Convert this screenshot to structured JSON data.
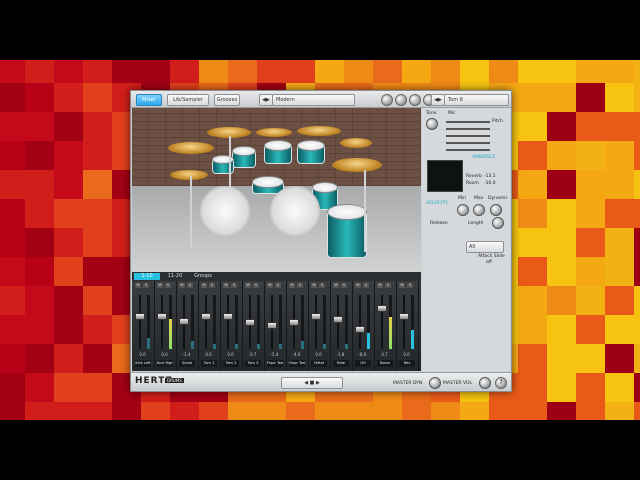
{
  "toolbar": {
    "mixer_label": "Mixer",
    "library_label": "Lib/Sampler",
    "grooves_label": "Grooves",
    "kit_name": "Modern",
    "preset_name": "Tom 8"
  },
  "stage_tabs": [
    "1-10",
    "11-20",
    "Groups"
  ],
  "side_panel": {
    "tone_label": "Tone",
    "mic_label": "Mic",
    "pitch_label": "Pitch",
    "ambience_label": "AMBIENCE",
    "velocity_label": "VELOCITY",
    "reverb_label": "Reverb",
    "reverb_value": "-13.5",
    "room_label": "Room",
    "room_value": "-16.0",
    "min_label": "Min",
    "max_label": "Max",
    "dynamic_label": "Dynamic",
    "release_label": "Release",
    "length_label": "Length",
    "dropdown_value": "All",
    "attack_label": "Attack Slide",
    "off_label": "off"
  },
  "mixer": {
    "channels": [
      {
        "name": "Kick Left",
        "value": "0.0",
        "level": 0.2
      },
      {
        "name": "Kick Right",
        "value": "0.0",
        "level": 0.55
      },
      {
        "name": "Snare",
        "value": "-3.4",
        "level": 0.15
      },
      {
        "name": "Tom 1",
        "value": "0.0",
        "level": 0.1
      },
      {
        "name": "Tom 2",
        "value": "0.0",
        "level": 0.1
      },
      {
        "name": "Tom 3",
        "value": "-3.7",
        "level": 0.1
      },
      {
        "name": "Floor Tom 1",
        "value": "-5.4",
        "level": 0.1
      },
      {
        "name": "Floor Tom 2",
        "value": "-4.0",
        "level": 0.15
      },
      {
        "name": "HiHat",
        "value": "0.0",
        "level": 0.1
      },
      {
        "name": "Ride",
        "value": "-1.8",
        "level": 0.1
      },
      {
        "name": "OH",
        "value": "-8.0",
        "level": 0.3
      },
      {
        "name": "Room",
        "value": "4.7",
        "level": 0.6
      },
      {
        "name": "Rev",
        "value": "0.0",
        "level": 0.35
      }
    ]
  },
  "footer": {
    "logo": "HERTZ",
    "logo_sub": "DRUMS",
    "master_dyn": "MASTER DYN",
    "master_vol": "MASTER VOL",
    "help": "?"
  },
  "colors": {
    "accent": "#27c2e0",
    "meter_green": "#8ee06a",
    "meter_yellow": "#e8d24a"
  }
}
